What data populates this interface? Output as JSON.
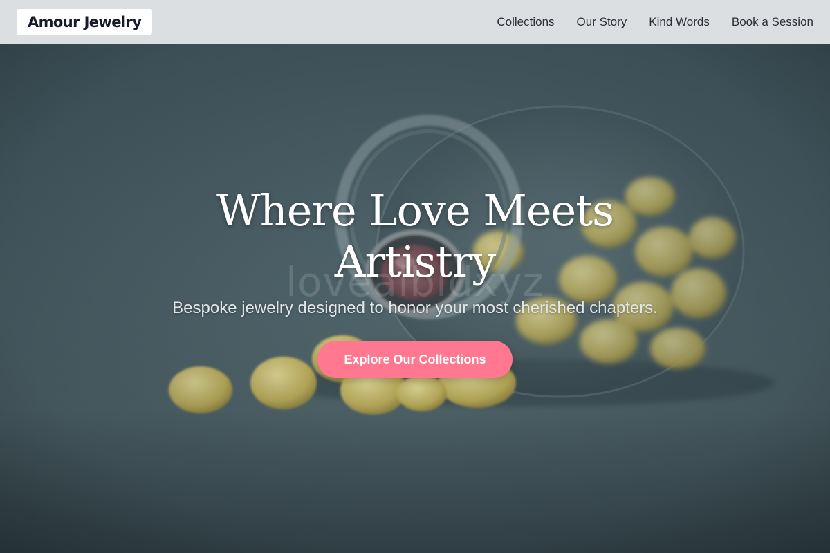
{
  "brand": {
    "name": "Amour Jewelry"
  },
  "nav": {
    "items": [
      "Collections",
      "Our Story",
      "Kind Words",
      "Book a Session"
    ]
  },
  "hero": {
    "headline_line1": "Where Love Meets",
    "headline_line2": "Artistry",
    "watermark": "lovealbidxyz",
    "subtitle": "Bespoke jewelry designed to honor your most cherished chapters.",
    "cta_label": "Explore Our Collections"
  },
  "colors": {
    "accent": "#ff7890",
    "header_bg": "#dcdfe1",
    "hero_bg": "#4b6068",
    "text_light": "#ffffff"
  }
}
